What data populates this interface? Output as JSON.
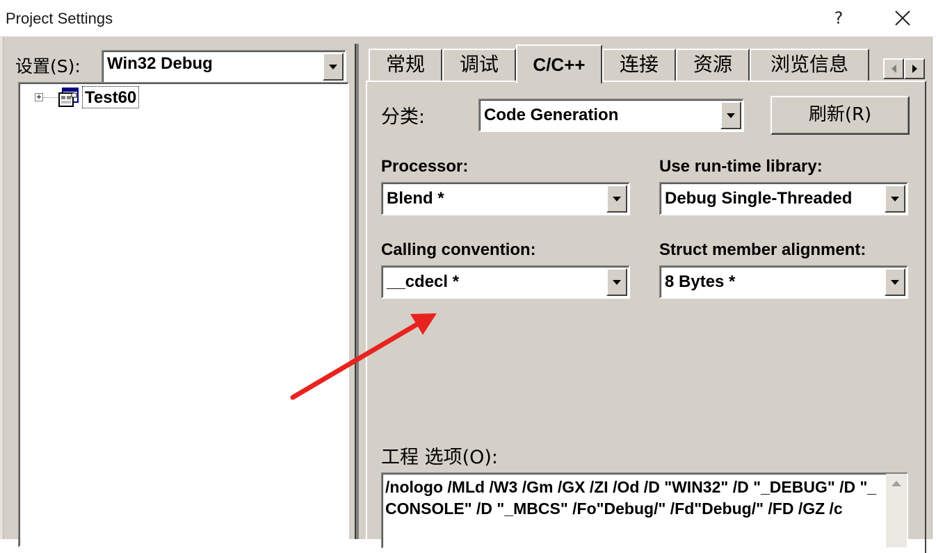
{
  "window": {
    "title": "Project Settings",
    "help_label": "?"
  },
  "settings": {
    "label": "设置(S):",
    "value": "Win32 Debug"
  },
  "tree": {
    "items": [
      {
        "label": "Test60"
      }
    ]
  },
  "tabs": [
    {
      "label": "常规"
    },
    {
      "label": "调试"
    },
    {
      "label": "C/C++"
    },
    {
      "label": "连接"
    },
    {
      "label": "资源"
    },
    {
      "label": "浏览信息"
    }
  ],
  "category": {
    "label": "分类:",
    "value": "Code Generation",
    "refresh_label": "刷新(R)"
  },
  "processor": {
    "label": "Processor:",
    "value": "Blend *"
  },
  "runtime": {
    "label": "Use run-time library:",
    "value": "Debug Single-Threaded"
  },
  "calling": {
    "label": "Calling convention:",
    "value": "__cdecl *"
  },
  "alignment": {
    "label": "Struct member alignment:",
    "value": "8 Bytes *"
  },
  "options": {
    "label": "工程 选项(O):",
    "text": "/nologo /MLd /W3 /Gm /GX /ZI /Od /D \"WIN32\" /D \"_DEBUG\" /D \"_CONSOLE\" /D \"_MBCS\" /Fo\"Debug/\" /Fd\"Debug/\" /FD /GZ /c"
  },
  "colors": {
    "dialog_bg": "#d4d0c8",
    "annotation_arrow": "#e8231f"
  }
}
